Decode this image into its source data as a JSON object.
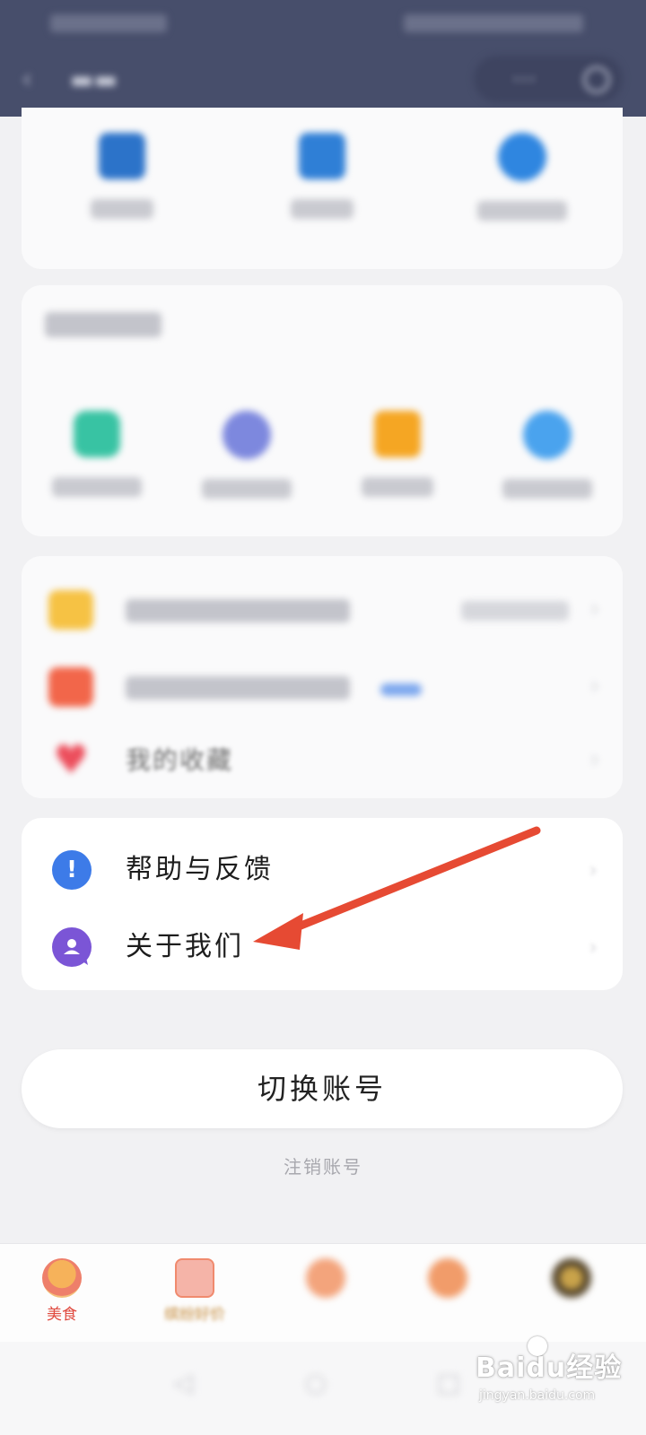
{
  "header": {
    "back_icon": "back-arrow-icon",
    "more_icon": "more-icon",
    "target_icon": "target-icon"
  },
  "colors": {
    "header_bg": "#474e6b",
    "page_bg": "#f1f1f3",
    "annotation_arrow": "#e64a33",
    "help_icon": "#3d7be8",
    "about_icon": "#7b55d6"
  },
  "top_grid": {
    "icons": [
      {
        "name": "blue-square-icon",
        "color": "#2c73c9"
      },
      {
        "name": "blue-square-icon",
        "color": "#2f7fd6"
      },
      {
        "name": "blue-circle-icon",
        "color": "#2f86e0"
      }
    ]
  },
  "common_section": {
    "icons": [
      {
        "name": "green-icon",
        "color": "#38c3a3"
      },
      {
        "name": "indigo-icon",
        "color": "#7d88de"
      },
      {
        "name": "orange-bag-icon",
        "color": "#f5a623"
      },
      {
        "name": "blue-circle-icon",
        "color": "#4aa3ee"
      }
    ]
  },
  "list1": {
    "items": [
      {
        "icon": "folder-icon",
        "icon_color": "#f6c244"
      },
      {
        "icon": "orange-gift-icon",
        "icon_color": "#f2664a"
      },
      {
        "icon": "heart-icon",
        "icon_color": "#ec4e5c",
        "label": "我的收藏"
      }
    ]
  },
  "help_card": {
    "items": [
      {
        "label": "帮助与反馈",
        "icon": "help-icon",
        "glyph": "!"
      },
      {
        "label": "关于我们",
        "icon": "about-icon"
      }
    ]
  },
  "switch_account_label": "切换账号",
  "cancel_account_label": "注销账号",
  "tabbar": {
    "tabs": [
      {
        "label": "美食",
        "icon": "burger-icon"
      },
      {
        "label": "缤纷好价",
        "icon": "shopping-bag-icon"
      },
      {
        "label": "",
        "icon": "orange-tab-icon"
      },
      {
        "label": "",
        "icon": "orange-tab-icon"
      },
      {
        "label": "",
        "icon": "avatar-icon"
      }
    ]
  },
  "watermark": {
    "main": "Baidu经验",
    "sub": "jingyan.baidu.com"
  }
}
